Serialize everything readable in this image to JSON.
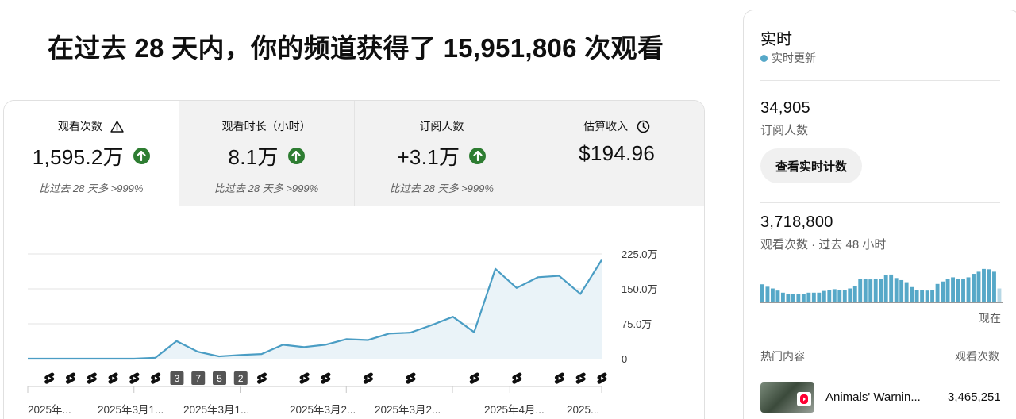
{
  "headline": "在过去 28 天内，你的频道获得了 15,951,806 次观看",
  "metrics": [
    {
      "label": "观看次数",
      "icon": "warning-icon",
      "value": "1,595.2万",
      "trend": "up",
      "sub": "比过去 28 天多 >999%"
    },
    {
      "label": "观看时长（小时）",
      "icon": "",
      "value": "8.1万",
      "trend": "up",
      "sub": "比过去 28 天多 >999%"
    },
    {
      "label": "订阅人数",
      "icon": "",
      "value": "+3.1万",
      "trend": "up",
      "sub": "比过去 28 天多 >999%"
    },
    {
      "label": "估算收入",
      "icon": "clock-icon",
      "value": "$194.96",
      "trend": "",
      "sub": ""
    }
  ],
  "chart_data": {
    "type": "area",
    "x_tick_labels": [
      "2025年...",
      "2025年3月1...",
      "2025年3月1...",
      "2025年3月2...",
      "2025年3月2...",
      "2025年4月...",
      "2025..."
    ],
    "y_tick_labels": [
      "225.0万",
      "150.0万",
      "75.0万",
      "0"
    ],
    "ylim": [
      0,
      2250000
    ],
    "values": [
      0,
      0,
      0,
      0,
      0,
      0,
      20000,
      380000,
      150000,
      50000,
      80000,
      100000,
      300000,
      250000,
      300000,
      420000,
      400000,
      540000,
      560000,
      720000,
      900000,
      570000,
      1930000,
      1520000,
      1750000,
      1780000,
      1390000,
      2120000
    ],
    "annotations": [
      {
        "index": 7,
        "text": "3"
      },
      {
        "index": 8,
        "text": "7"
      },
      {
        "index": 9,
        "text": "5"
      },
      {
        "index": 10,
        "text": "2"
      }
    ],
    "shorts_marker_indices": [
      1,
      2,
      3,
      4,
      5,
      6,
      11,
      13,
      14,
      16,
      18,
      21,
      23,
      25,
      26,
      27
    ],
    "color": "#4a9dc4",
    "fill": "#eaf3f8",
    "grid": true
  },
  "realtime": {
    "title": "实时",
    "status": "实时更新",
    "subscribers": "34,905",
    "subscribers_label": "订阅人数",
    "button": "查看实时计数",
    "views": "3,718,800",
    "views_label": "观看次数 · 过去 48 小时",
    "bars": [
      0.54,
      0.47,
      0.42,
      0.36,
      0.3,
      0.25,
      0.27,
      0.27,
      0.27,
      0.3,
      0.3,
      0.3,
      0.35,
      0.38,
      0.4,
      0.38,
      0.38,
      0.42,
      0.5,
      0.7,
      0.7,
      0.68,
      0.7,
      0.7,
      0.8,
      0.82,
      0.72,
      0.66,
      0.6,
      0.46,
      0.38,
      0.37,
      0.36,
      0.37,
      0.55,
      0.62,
      0.7,
      0.74,
      0.7,
      0.7,
      0.74,
      0.84,
      0.9,
      0.98,
      0.97,
      0.9,
      0.42
    ],
    "now_label": "现在",
    "top_content_label": "热门内容",
    "views_col_label": "观看次数",
    "top_item": {
      "title": "Animals' Warnin...",
      "views": "3,465,251"
    }
  },
  "colors": {
    "accent": "#4a9dc4",
    "up": "#2e7d32",
    "bar": "#56a8c8",
    "bar_last": "#b6d7e5"
  }
}
